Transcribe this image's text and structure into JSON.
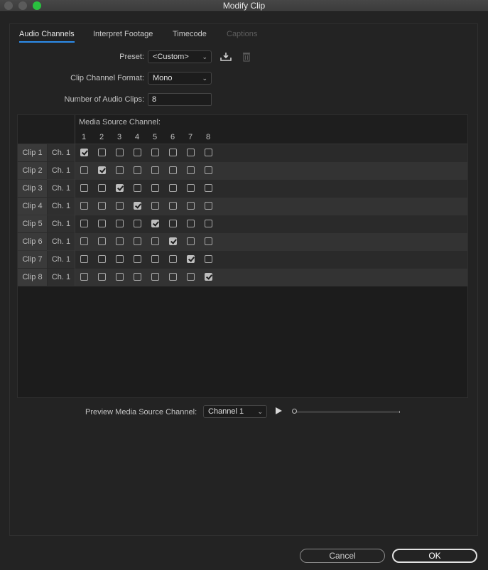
{
  "window": {
    "title": "Modify Clip"
  },
  "tabs": [
    {
      "label": "Audio Channels",
      "active": true,
      "enabled": true
    },
    {
      "label": "Interpret Footage",
      "active": false,
      "enabled": true
    },
    {
      "label": "Timecode",
      "active": false,
      "enabled": true
    },
    {
      "label": "Captions",
      "active": false,
      "enabled": false
    }
  ],
  "form": {
    "preset_label": "Preset:",
    "preset_value": "<Custom>",
    "format_label": "Clip Channel Format:",
    "format_value": "Mono",
    "num_clips_label": "Number of Audio Clips:",
    "num_clips_value": "8"
  },
  "grid": {
    "media_source_label": "Media Source Channel:",
    "channels": [
      "1",
      "2",
      "3",
      "4",
      "5",
      "6",
      "7",
      "8"
    ],
    "rows": [
      {
        "clip": "Clip 1",
        "ch": "Ch. 1",
        "checked": 1
      },
      {
        "clip": "Clip 2",
        "ch": "Ch. 1",
        "checked": 2
      },
      {
        "clip": "Clip 3",
        "ch": "Ch. 1",
        "checked": 3
      },
      {
        "clip": "Clip 4",
        "ch": "Ch. 1",
        "checked": 4
      },
      {
        "clip": "Clip 5",
        "ch": "Ch. 1",
        "checked": 5
      },
      {
        "clip": "Clip 6",
        "ch": "Ch. 1",
        "checked": 6
      },
      {
        "clip": "Clip 7",
        "ch": "Ch. 1",
        "checked": 7
      },
      {
        "clip": "Clip 8",
        "ch": "Ch. 1",
        "checked": 8
      }
    ]
  },
  "preview": {
    "label": "Preview Media Source Channel:",
    "channel_value": "Channel 1",
    "progress": 0
  },
  "buttons": {
    "cancel": "Cancel",
    "ok": "OK"
  },
  "colors": {
    "accent": "#2d8ceb",
    "maximize": "#29c13f"
  }
}
